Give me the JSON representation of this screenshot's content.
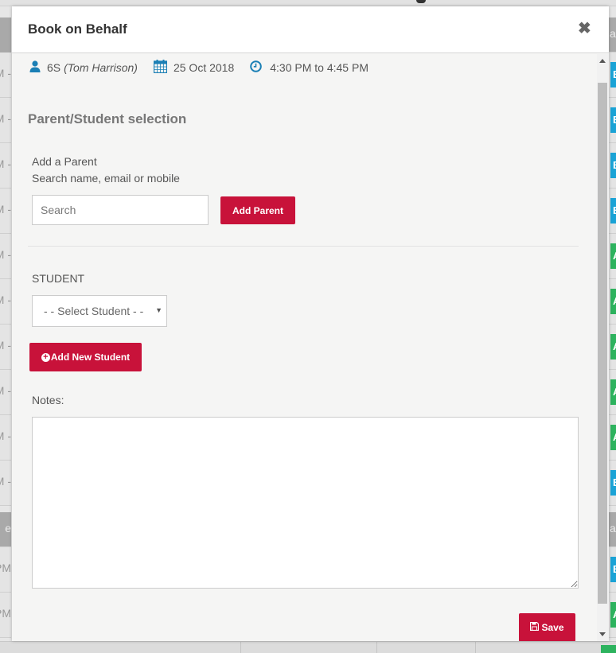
{
  "modal": {
    "title": "Book on Behalf",
    "close_icon": "close-icon",
    "meta": {
      "class_code": "6S",
      "teacher": "(Tom Harrison)",
      "date": "25 Oct 2018",
      "time_range": "4:30 PM to 4:45 PM",
      "icons": [
        "user-icon",
        "calendar-icon",
        "clock-icon"
      ]
    },
    "section_title": "Parent/Student selection",
    "parent": {
      "label": "Add a Parent",
      "hint": "Search name, email or mobile",
      "search_placeholder": "Search",
      "search_value": "",
      "add_button": "Add Parent"
    },
    "student": {
      "label": "STUDENT",
      "select_value": "- - Select Student - -",
      "add_button": "Add New Student"
    },
    "notes": {
      "label": "Notes:",
      "value": ""
    },
    "save_button": "Save"
  },
  "background": {
    "left_fragments": [
      "M -",
      "M -",
      "M -",
      "M -",
      "M -",
      "M -",
      "M -",
      "M -",
      "M -",
      "M -",
      "e",
      "PM",
      "PM"
    ],
    "right_fragments": [
      "a",
      "B",
      "B",
      "B",
      "B",
      "A",
      "A",
      "A",
      "A",
      "A",
      "B",
      "a",
      "B",
      "A"
    ]
  },
  "colors": {
    "primary": "#c8123a",
    "icon_blue": "#1a7fb5",
    "pill_blue": "#1aa3d6",
    "pill_green": "#2db35e"
  }
}
